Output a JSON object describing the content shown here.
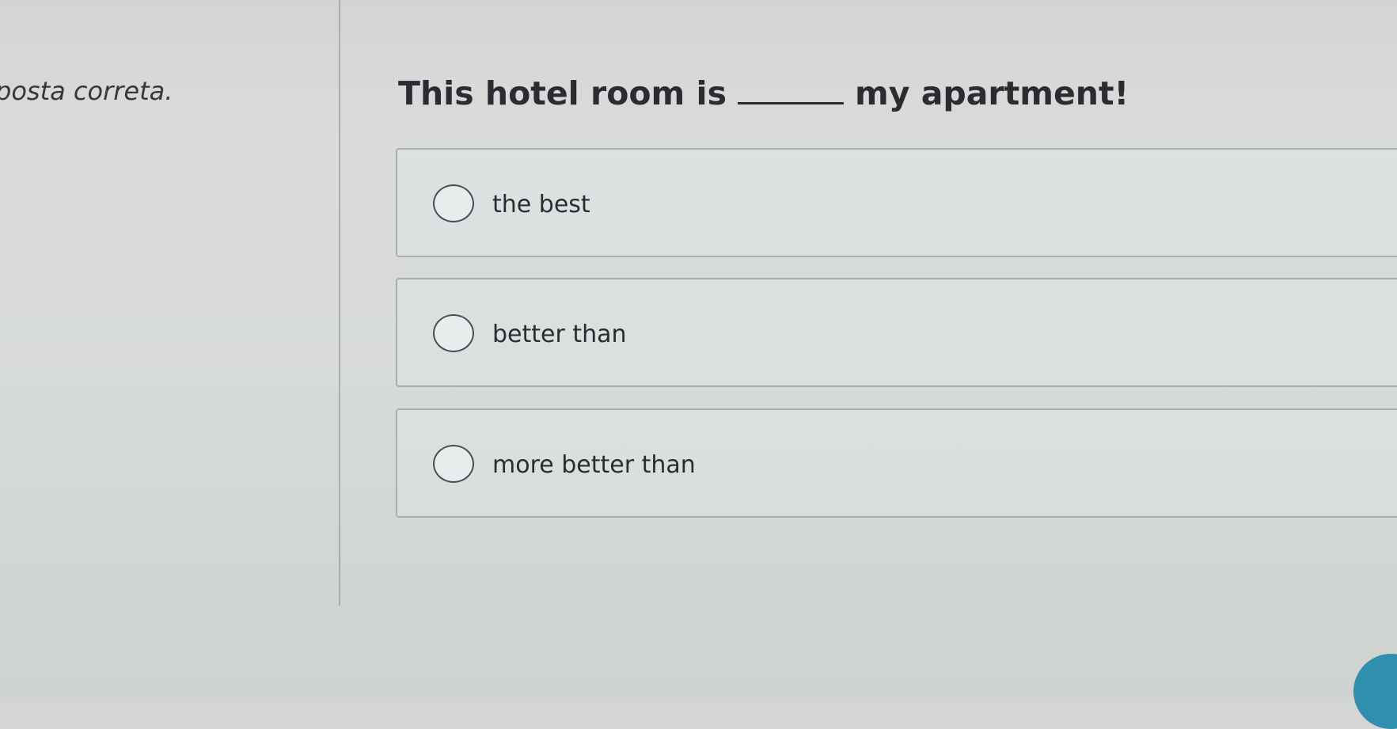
{
  "instruction": "posta correta.",
  "question": {
    "before_blank": "This hotel room is",
    "after_blank": "my apartment!"
  },
  "options": [
    {
      "label": "the best"
    },
    {
      "label": "better than"
    },
    {
      "label": "more better than"
    }
  ],
  "colors": {
    "accent": "#2f8fae"
  }
}
